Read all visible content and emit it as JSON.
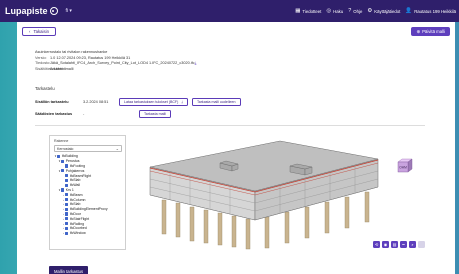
{
  "topbar": {
    "brand": "Lupapiste",
    "lang": "fi",
    "nav": [
      {
        "icon": "▦",
        "label": "Tiedotteet",
        "name": "nav-tiedotteet"
      },
      {
        "icon": "◎",
        "label": "Haku",
        "name": "nav-haku"
      },
      {
        "icon": "?",
        "label": "Ohje",
        "name": "nav-ohje"
      },
      {
        "icon": "⚙",
        "label": "Käyttäjätiedot",
        "name": "nav-kayttajatiedot"
      },
      {
        "icon": "👤",
        "label": "Rautatus 199 Heikkilä",
        "name": "nav-user"
      }
    ]
  },
  "back_label": "Takaisin",
  "primary_label": "Päivitä malli",
  "info": [
    {
      "k": "",
      "v": "Asuinkerrostalo tai rivitalon rakennushanke"
    },
    {
      "k": "Versio:",
      "v": "1.0 12.07.2024 09:23, Rautatus 199 Heikkilä 31"
    },
    {
      "k": "Tiedosto:",
      "v": "Jäkä_Sotalahti_IFC4_Arch_Survey_Point_City_Lot_LOD4 1.IFC_20240722_c3020.ifc"
    },
    {
      "k": "Sisältötietokanta:",
      "v": "Arkkitehtimalli"
    }
  ],
  "section_title": "Tarkastelu",
  "rows": [
    {
      "label": "Sisällön tarkastelu",
      "value": "3.2.2024 08:51",
      "buttons": [
        "Lataa tarkastuksen tulokset (BCF)",
        "Tarkasta malli uudelleen"
      ]
    },
    {
      "label": "Säädösten tarkastus",
      "value": "-",
      "buttons": [
        "Tarkasta malli"
      ]
    }
  ],
  "tree": {
    "title": "Rakenne",
    "select_value": "Kerrostalo",
    "items": [
      {
        "indent": 0,
        "caret": "▾",
        "label": "IfcBuilding"
      },
      {
        "indent": 1,
        "caret": "▾",
        "label": "Perustus"
      },
      {
        "indent": 2,
        "caret": "",
        "label": "IfcFooting"
      },
      {
        "indent": 1,
        "caret": "▾",
        "label": "Pohjakerros"
      },
      {
        "indent": 2,
        "caret": "",
        "label": "IfcBeamFlight"
      },
      {
        "indent": 2,
        "caret": "",
        "label": "IfcSlab"
      },
      {
        "indent": 2,
        "caret": "",
        "label": "IfcWall"
      },
      {
        "indent": 1,
        "caret": "▾",
        "label": "Krs 1"
      },
      {
        "indent": 2,
        "caret": "›",
        "label": "IfcBeam"
      },
      {
        "indent": 2,
        "caret": "›",
        "label": "IfcColumn"
      },
      {
        "indent": 2,
        "caret": "›",
        "label": "IfcSlab"
      },
      {
        "indent": 2,
        "caret": "›",
        "label": "IfcBuildingElementProxy"
      },
      {
        "indent": 2,
        "caret": "›",
        "label": "IfcDoor"
      },
      {
        "indent": 2,
        "caret": "›",
        "label": "IfcStairFlight"
      },
      {
        "indent": 2,
        "caret": "›",
        "label": "IfcRailing"
      },
      {
        "indent": 2,
        "caret": "›",
        "label": "IfcDoorbed"
      },
      {
        "indent": 2,
        "caret": "›",
        "label": "IfcWindow"
      }
    ]
  },
  "cube_label": "OHM",
  "viewer_tools": [
    {
      "icon": "⟲",
      "name": "rotate-icon"
    },
    {
      "icon": "◉",
      "name": "focus-icon"
    },
    {
      "icon": "▤",
      "name": "layers-icon"
    },
    {
      "icon": "━",
      "name": "section-icon"
    },
    {
      "icon": "⌕",
      "name": "zoom-icon"
    },
    {
      "icon": "",
      "name": "fullscreen-icon"
    }
  ],
  "footer_label": "Mallin tarkastus"
}
